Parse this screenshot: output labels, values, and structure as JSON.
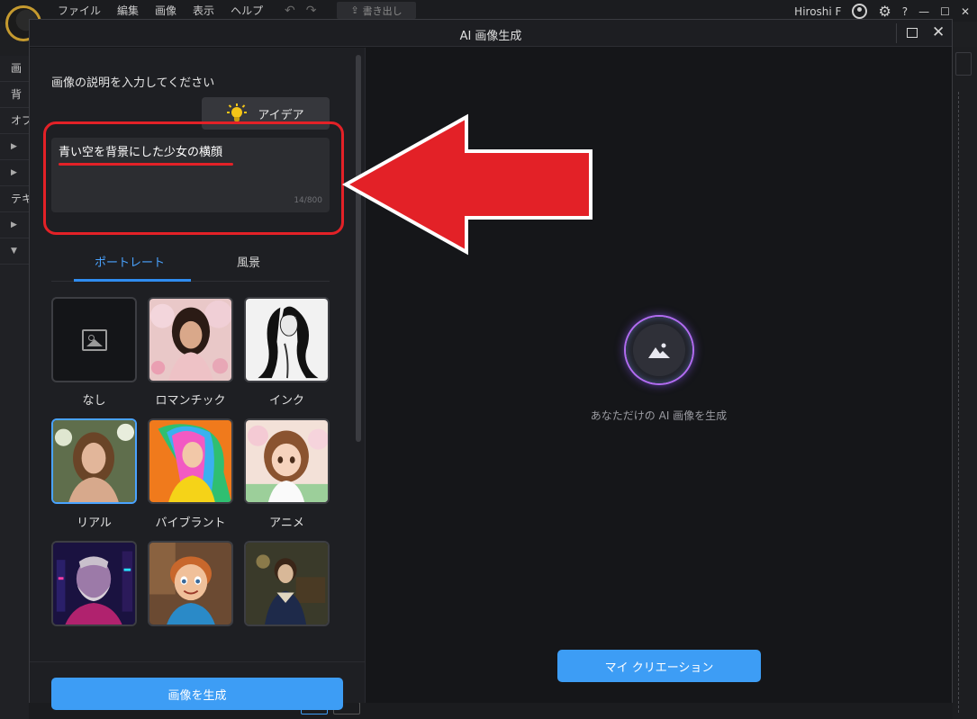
{
  "app": {
    "menu": [
      "ファイル",
      "編集",
      "画像",
      "表示",
      "ヘルプ"
    ],
    "export_label": "書き出し",
    "user_name": "Hiroshi F",
    "help_glyph": "?",
    "minimize_glyph": "—",
    "maximize_glyph": "☐",
    "close_glyph": "✕"
  },
  "left_panel_items": [
    "画",
    "背",
    "オブ",
    "▶",
    "▶",
    "テキ",
    "▶",
    "▼"
  ],
  "dialog": {
    "title": "AI 画像生成",
    "prompt_label": "画像の説明を入力してください",
    "idea_button": "アイデア",
    "prompt_value": "青い空を背景にした少女の横顔",
    "char_count": "14/800",
    "tabs": [
      {
        "label": "ポートレート",
        "active": true
      },
      {
        "label": "風景",
        "active": false
      }
    ],
    "styles": [
      {
        "label": "なし",
        "icon": "image-icon",
        "selected": false
      },
      {
        "label": "ロマンチック",
        "selected": false
      },
      {
        "label": "インク",
        "selected": false
      },
      {
        "label": "リアル",
        "selected": true
      },
      {
        "label": "バイブラント",
        "selected": false
      },
      {
        "label": "アニメ",
        "selected": false
      },
      {
        "label": "",
        "selected": false
      },
      {
        "label": "",
        "selected": false
      },
      {
        "label": "",
        "selected": false
      }
    ],
    "generate_button": "画像を生成",
    "empty_state_text": "あなただけの AI 画像を生成",
    "my_creations_button": "マイ クリエーション"
  },
  "colors": {
    "accent": "#3d9df5",
    "annotation": "#e32127",
    "tab_active": "#4aa3ff"
  }
}
